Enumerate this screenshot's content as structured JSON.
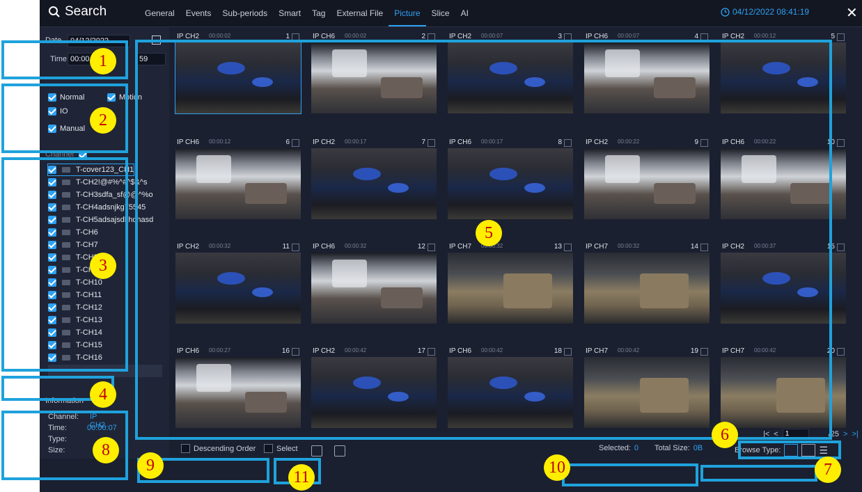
{
  "search": {
    "title": "Search"
  },
  "tabs": [
    "General",
    "Events",
    "Sub-periods",
    "Smart",
    "Tag",
    "External File",
    "Picture",
    "Slice",
    "AI"
  ],
  "active_tab": "Picture",
  "datetime": "04/12/2022 08:41:19",
  "left_panel": {
    "date_label": "Date",
    "date_value": "04/12/2022",
    "time_label": "Time",
    "time_start": "00:00",
    "time_end_suffix": "59",
    "record_types": [
      {
        "label": "Normal",
        "checked": true
      },
      {
        "label": "Motion",
        "checked": true
      },
      {
        "label": "IO",
        "checked": true
      },
      {
        "label": "Manual",
        "checked": true
      }
    ],
    "channel_label": "Channel",
    "channels": [
      "T-cover123_CH1",
      "T-CH2!@#%^#^$&^s",
      "T-CH3sdfa_sf@@^%o",
      "T-CH4adsnjkg75545",
      "T-CH5adsajsdkhdhasd",
      "T-CH6",
      "T-CH7",
      "T-CH8",
      "T-CH9",
      "T-CH10",
      "T-CH11",
      "T-CH12",
      "T-CH13",
      "T-CH14",
      "T-CH15",
      "T-CH16"
    ],
    "information": {
      "title": "Information",
      "channel_label": "Channel:",
      "channel_value": "IP CH2",
      "time_label": "Time:",
      "time_value": "00:00:07",
      "type_label": "Type:",
      "type_value": "",
      "size_label": "Size:",
      "size_value": ""
    }
  },
  "thumbnails": [
    {
      "channel": "IP CH2",
      "time": "00:00:02",
      "num": "1",
      "scene": "scene1",
      "selected": true
    },
    {
      "channel": "IP CH6",
      "time": "00:00:02",
      "num": "2",
      "scene": "scene2"
    },
    {
      "channel": "IP CH2",
      "time": "00:00:07",
      "num": "3",
      "scene": "scene1"
    },
    {
      "channel": "IP CH6",
      "time": "00:00:07",
      "num": "4",
      "scene": "scene2"
    },
    {
      "channel": "IP CH2",
      "time": "00:00:12",
      "num": "5",
      "scene": "scene1"
    },
    {
      "channel": "IP CH6",
      "time": "00:00:12",
      "num": "6",
      "scene": "scene2"
    },
    {
      "channel": "IP CH2",
      "time": "00:00:17",
      "num": "7",
      "scene": "scene1"
    },
    {
      "channel": "IP CH6",
      "time": "00:00:17",
      "num": "8",
      "scene": "scene1"
    },
    {
      "channel": "IP CH2",
      "time": "00:00:22",
      "num": "9",
      "scene": "scene2"
    },
    {
      "channel": "IP CH6",
      "time": "00:00:22",
      "num": "10",
      "scene": "scene2"
    },
    {
      "channel": "IP CH2",
      "time": "00:00:32",
      "num": "11",
      "scene": "scene1"
    },
    {
      "channel": "IP CH6",
      "time": "00:00:32",
      "num": "12",
      "scene": "scene2"
    },
    {
      "channel": "IP CH7",
      "time": "00:00:32",
      "num": "13",
      "scene": "scene3"
    },
    {
      "channel": "IP CH7",
      "time": "00:00:32",
      "num": "14",
      "scene": "scene3"
    },
    {
      "channel": "IP CH2",
      "time": "00:00:37",
      "num": "15",
      "scene": "scene1"
    },
    {
      "channel": "IP CH6",
      "time": "00:00:27",
      "num": "16",
      "scene": "scene2"
    },
    {
      "channel": "IP CH2",
      "time": "00:00:42",
      "num": "17",
      "scene": "scene1"
    },
    {
      "channel": "IP CH6",
      "time": "00:00:42",
      "num": "18",
      "scene": "scene1"
    },
    {
      "channel": "IP CH7",
      "time": "00:00:42",
      "num": "19",
      "scene": "scene3"
    },
    {
      "channel": "IP CH7",
      "time": "00:00:42",
      "num": "20",
      "scene": "scene3"
    }
  ],
  "pager": {
    "current": "1",
    "total": "/25"
  },
  "bottom": {
    "descending": "Descending Order",
    "select": "Select",
    "selected_label": "Selected:",
    "selected_value": "0",
    "total_label": "Total Size:",
    "total_value": "0B",
    "browse_type": "Browse Type:"
  },
  "callouts": [
    "1",
    "2",
    "3",
    "4",
    "5",
    "6",
    "7",
    "8",
    "9",
    "10",
    "11"
  ],
  "colors": {
    "accent": "#2ea1f2",
    "callout_frame": "#1fa2dc",
    "callout_badge": "#ffee00",
    "callout_text": "#c00000"
  }
}
